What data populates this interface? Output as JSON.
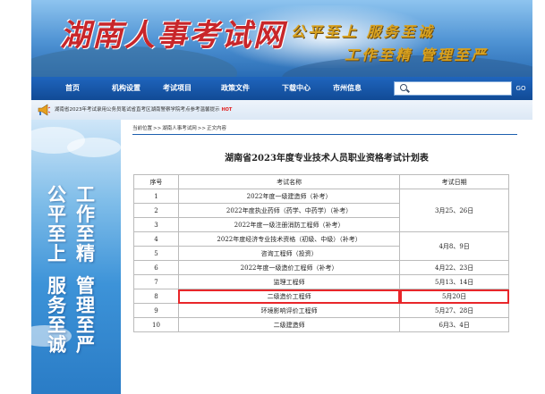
{
  "banner": {
    "site_title": "湖南人事考试网",
    "slogan_line1": "公平至上 服务至诚",
    "slogan_line2": "工作至精 管理至严"
  },
  "nav": {
    "items": [
      "首页",
      "机构设置",
      "考试项目",
      "政策文件",
      "下载中心",
      "市州信息"
    ],
    "search_placeholder": "",
    "go_label": "GO"
  },
  "notice": {
    "text": "湖南省2023年考试录用公务员笔试省直考区湖南警察学院考点参考温馨提示",
    "hot_label": "HOT"
  },
  "left_panel": {
    "col1": [
      "公",
      "平",
      "至",
      "上",
      "服",
      "务",
      "至",
      "诚"
    ],
    "col2": [
      "工",
      "作",
      "至",
      "精",
      "管",
      "理",
      "至",
      "严"
    ]
  },
  "breadcrumb": {
    "prefix": "当前位置",
    "items": [
      "湖南人事考试网",
      "正文内容"
    ],
    "separator": ">>"
  },
  "document": {
    "title": "湖南省2023年度专业技术人员职业资格考试计划表"
  },
  "table": {
    "headers": [
      "序号",
      "考试名称",
      "考试日期"
    ],
    "rows": [
      {
        "no": "1",
        "name": "2022年度一级建造师（补考）",
        "date": "3月25、26日"
      },
      {
        "no": "2",
        "name": "2022年度执业药师（药学、中药学）（补考）",
        "date": ""
      },
      {
        "no": "3",
        "name": "2022年度一级注册消防工程师（补考）",
        "date": ""
      },
      {
        "no": "4",
        "name": "2022年度经济专业技术资格（初级、中级）（补考）",
        "date": "4月8、9日"
      },
      {
        "no": "5",
        "name": "咨询工程师（投资）",
        "date": ""
      },
      {
        "no": "6",
        "name": "2022年度一级造价工程师（补考）",
        "date": "4月22、23日"
      },
      {
        "no": "7",
        "name": "监理工程师",
        "date": "5月13、14日"
      },
      {
        "no": "8",
        "name": "二级造价工程师",
        "date": "5月20日"
      },
      {
        "no": "9",
        "name": "环境影响评价工程师",
        "date": "5月27、28日"
      },
      {
        "no": "10",
        "name": "二级建造师",
        "date": "6月3、4日"
      }
    ]
  },
  "colors": {
    "nav_bg": "#1a5cb0",
    "title_red": "#c8262a",
    "slogan_gold": "#d9a21f",
    "highlight_red": "#e8262a",
    "breadcrumb_line": "#1d5fae"
  }
}
